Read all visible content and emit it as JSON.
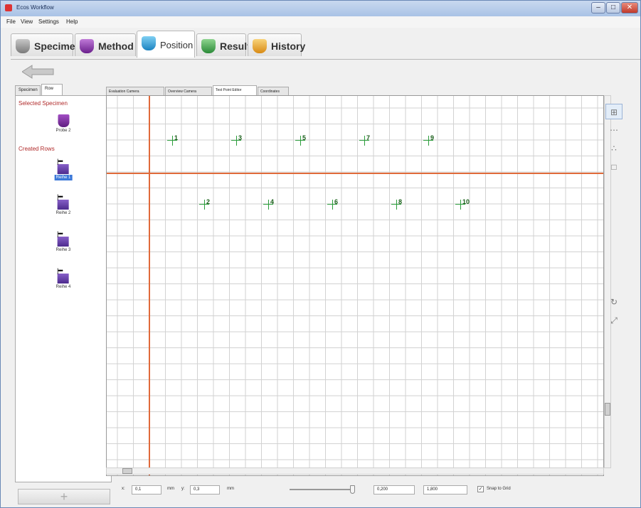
{
  "window": {
    "title": "Ecos Workflow",
    "controls": [
      "–",
      "□",
      "✕"
    ]
  },
  "menu": [
    "File",
    "View",
    "Settings",
    "Help"
  ],
  "main_tabs": [
    {
      "label": "Specimen",
      "color": "#9a9a9a"
    },
    {
      "label": "Method",
      "color": "#8a3fb0"
    },
    {
      "label": "Position",
      "color": "#2f9fd8"
    },
    {
      "label": "Result",
      "color": "#3aa84a"
    },
    {
      "label": "History",
      "color": "#e8a020"
    }
  ],
  "active_main_tab": "Position",
  "left_tabs": [
    "Specimen",
    "Row"
  ],
  "left_panel": {
    "selected_specimen_title": "Selected Specimen",
    "selected_specimen": "Probe 2",
    "created_rows_title": "Created Rows",
    "rows": [
      "Reihe 1",
      "Reihe 2",
      "Reihe 3",
      "Reihe 4"
    ],
    "add_label": "+"
  },
  "view_tabs": [
    "Evaluation Camera",
    "Overview Camera",
    "Test Point Editor",
    "Coordinates"
  ],
  "active_view_tab": "Test Point Editor",
  "test_points": [
    "1",
    "2",
    "3",
    "4",
    "5",
    "6",
    "7",
    "8",
    "9",
    "10"
  ],
  "tools": [
    "grid-icon",
    "row-icon",
    "scatter-icon",
    "rectangle-icon",
    "rotate-icon",
    "transform-icon"
  ],
  "bottom": {
    "x_label": "x:",
    "x_value": "0,1",
    "x_unit": "mm",
    "y_label": "y:",
    "y_value": "0,3",
    "y_unit": "mm",
    "field1": "0,200",
    "field2": "1,800",
    "snap_label": "Snap to Grid",
    "snap_checked": true
  }
}
